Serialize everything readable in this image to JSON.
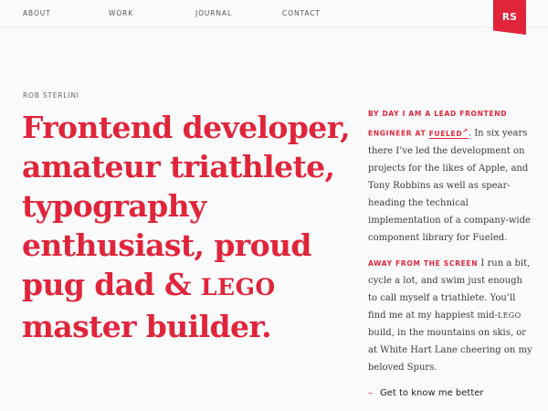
{
  "nav": {
    "items": [
      "ABOUT",
      "WORK",
      "JOURNAL",
      "CONTACT"
    ],
    "logo": "RS"
  },
  "hero": {
    "author": "ROB STERLINI",
    "headline_main": "Frontend developer, amateur triathlete, typography enthusiast, proud pug dad & ",
    "headline_lego": "LEGO",
    "headline_end": " master builder."
  },
  "aside": {
    "p1_lead_a": "BY DAY I AM A LEAD FRONTEND ENGINEER AT ",
    "p1_link": "FUELED",
    "p1_link_icon": "↗",
    "p1_body": ". In six years there I’ve led the development on projects for the likes of Apple, and Tony Robbins as well as spear-heading the technical implementation of a company-wide component library for Fueled.",
    "p2_lead": "AWAY FROM THE SCREEN",
    "p2_body_a": " I run a bit, cycle a lot, and swim just enough to call myself a triathlete. You’ll find me at my happiest mid-",
    "p2_lego": "LEGO",
    "p2_body_b": " build, in the mountains on skis, or at White Hart Lane cheering on my beloved Spurs.",
    "cta_dash": "–",
    "cta_label": "Get to know me better"
  },
  "colors": {
    "accent": "#e0253b",
    "background": "#fbfbfb",
    "body_text": "#3a3a3a"
  }
}
